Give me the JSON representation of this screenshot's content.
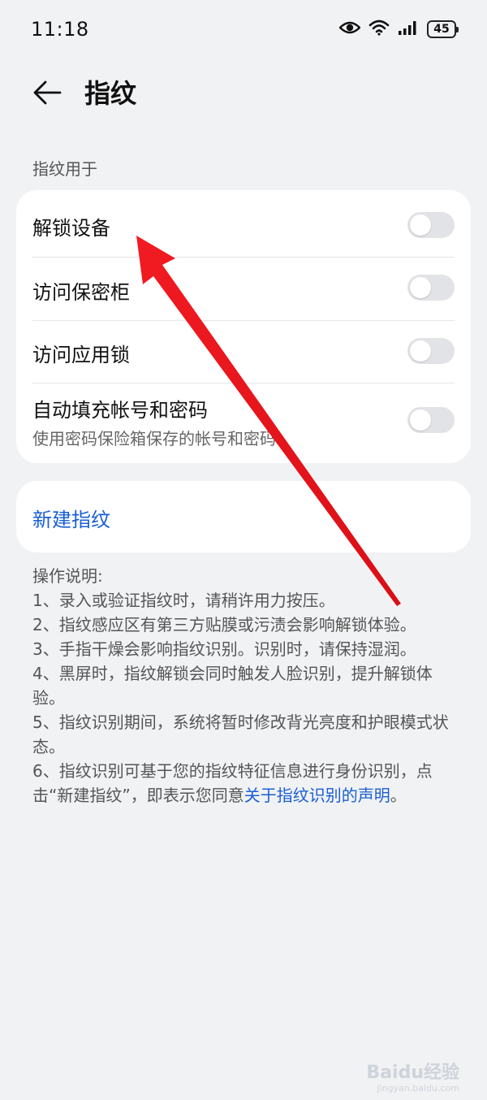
{
  "status_bar": {
    "time": "11:18",
    "battery": "45",
    "icons": [
      "eye-icon",
      "wifi-icon",
      "signal-icon",
      "battery-icon"
    ]
  },
  "header": {
    "title": "指纹",
    "back_icon": "back-arrow-icon"
  },
  "section": {
    "label": "指纹用于"
  },
  "settings": [
    {
      "label": "解锁设备",
      "sublabel": "",
      "enabled": false
    },
    {
      "label": "访问保密柜",
      "sublabel": "",
      "enabled": false
    },
    {
      "label": "访问应用锁",
      "sublabel": "",
      "enabled": false
    },
    {
      "label": "自动填充帐号和密码",
      "sublabel": "使用密码保险箱保存的帐号和密码",
      "enabled": false
    }
  ],
  "new_fingerprint": {
    "label": "新建指纹"
  },
  "instructions": {
    "title": "操作说明:",
    "items": [
      "1、录入或验证指纹时，请稍许用力按压。",
      "2、指纹感应区有第三方贴膜或污渍会影响解锁体验。",
      "3、手指干燥会影响指纹识别。识别时，请保持湿润。",
      "4、黑屏时，指纹解锁会同时触发人脸识别，提升解锁体验。",
      "5、指纹识别期间，系统将暂时修改背光亮度和护眼模式状态。"
    ],
    "last_item_prefix": "6、指纹识别可基于您的指纹特征信息进行身份识别，点击“新建指纹”，即表示您同意",
    "last_item_link": "关于指纹识别的声明",
    "last_item_suffix": "。"
  },
  "watermark": {
    "text": "Baidu经验",
    "sub": "jingyan.baidu.com"
  },
  "colors": {
    "background": "#f1f2f4",
    "card": "#ffffff",
    "link": "#1a5fd4",
    "toggle_off": "#e2e3e6",
    "annotation_arrow": "#e8141b"
  }
}
